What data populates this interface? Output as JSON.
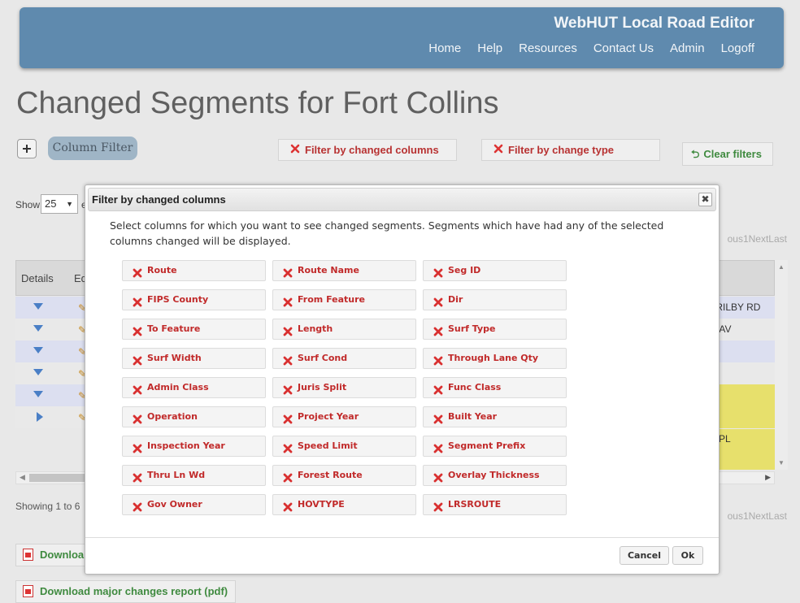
{
  "header": {
    "app_title": "WebHUT Local Road Editor",
    "nav": [
      "Home",
      "Help",
      "Resources",
      "Contact Us",
      "Admin",
      "Logoff"
    ]
  },
  "page_title": "Changed Segments for Fort Collins",
  "filter_bar": {
    "column_filter_label": "Column Filter",
    "changed_columns_label": "Filter by changed columns",
    "change_type_label": "Filter by change type",
    "clear_label": "Clear filters"
  },
  "grid": {
    "show_label": "Show",
    "page_size": "25",
    "show_suffix": "e",
    "pager_top": "ous1NextLast",
    "pager_bottom": "ous1NextLast",
    "col_details": "Details",
    "col_edit": "Ed",
    "rows": [
      {
        "right_text": "TRILBY RD"
      },
      {
        "right_text": "N AV"
      },
      {
        "right_text": ""
      },
      {
        "right_text": ""
      },
      {
        "right_text": ""
      },
      {
        "right_text": ""
      }
    ],
    "yellow_text": "PL",
    "showing_text": "Showing 1 to 6"
  },
  "downloads": {
    "first_label": "Downloa",
    "major_label": "Download major changes report (pdf)"
  },
  "modal": {
    "title": "Filter by changed columns",
    "description": "Select columns for which you want to see changed segments. Segments which have had any of the selected columns changed will be displayed.",
    "columns": [
      "Route",
      "Route Name",
      "Seg ID",
      "FIPS County",
      "From Feature",
      "Dir",
      "To Feature",
      "Length",
      "Surf Type",
      "Surf Width",
      "Surf Cond",
      "Through Lane Qty",
      "Admin Class",
      "Juris Split",
      "Func Class",
      "Operation",
      "Project Year",
      "Built Year",
      "Inspection Year",
      "Speed Limit",
      "Segment Prefix",
      "Thru Ln Wd",
      "Forest Route",
      "Overlay Thickness",
      "Gov Owner",
      "HOVTYPE",
      "LRSROUTE"
    ],
    "cancel_label": "Cancel",
    "ok_label": "Ok"
  }
}
